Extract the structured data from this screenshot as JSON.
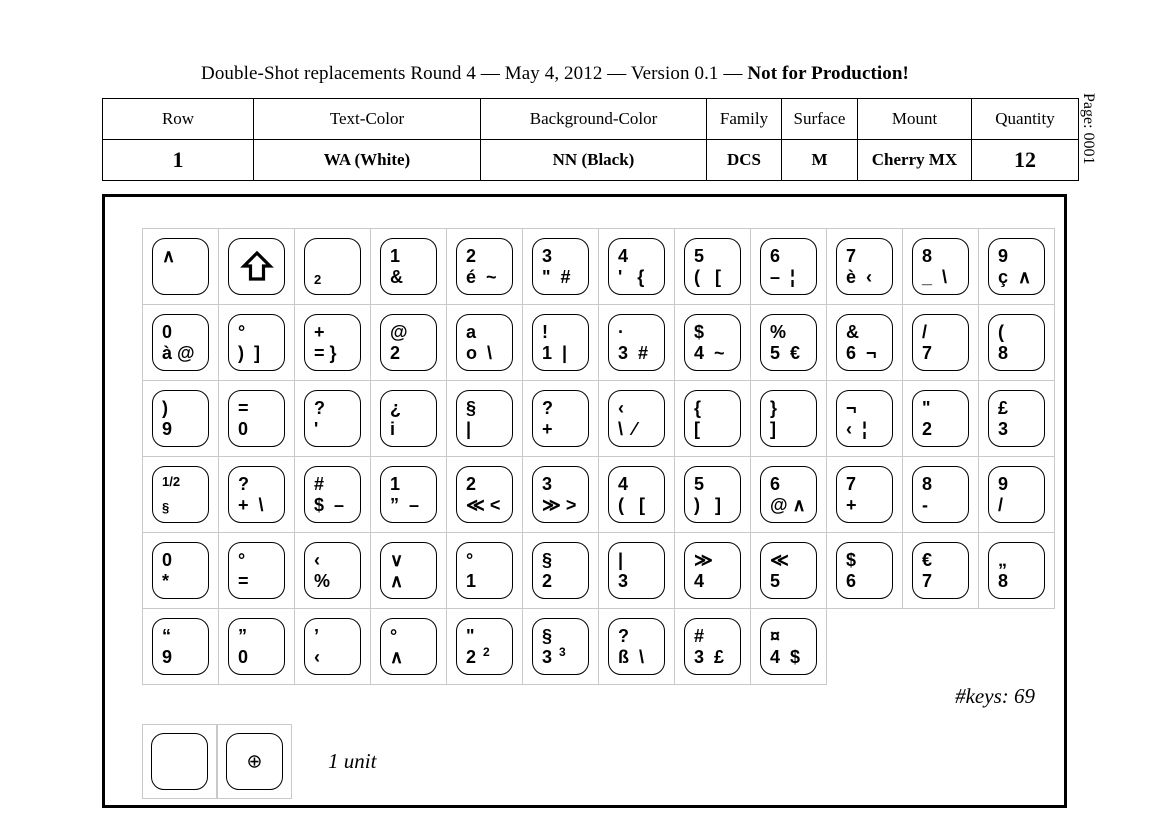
{
  "title": {
    "normal": "Double-Shot replacements Round 4 — May 4, 2012 — Version 0.1 — ",
    "bold": "Not for Production!"
  },
  "page_label": "Page: 0001",
  "info_table": {
    "headers": [
      "Row",
      "Text-Color",
      "Background-Color",
      "Family",
      "Surface",
      "Mount",
      "Quantity"
    ],
    "values": [
      "1",
      "WA (White)",
      "NN (Black)",
      "DCS",
      "M",
      "Cherry MX",
      "12"
    ]
  },
  "keys_note": "#keys: 69",
  "unit_legend": {
    "label": "1 unit",
    "marker": "⊕"
  },
  "key_rows": [
    [
      {
        "top": "∧",
        "bot": "",
        "align": "left"
      },
      {
        "icon": "shift-up-arrow"
      },
      {
        "top": "",
        "bot": "2",
        "align": "left",
        "small": true
      },
      {
        "top": "1",
        "bot": "&",
        "align": "left"
      },
      {
        "top": "2",
        "bot": "é  ~",
        "align": "left"
      },
      {
        "top": "3",
        "bot": "\"  #",
        "align": "left"
      },
      {
        "top": "4",
        "bot": "'   {",
        "align": "left"
      },
      {
        "top": "5",
        "bot": "(   [",
        "align": "left"
      },
      {
        "top": "6",
        "bot": "–  ¦",
        "align": "left"
      },
      {
        "top": "7",
        "bot": "è  ‹",
        "align": "left"
      },
      {
        "top": "8",
        "bot": "_  \\",
        "align": "left"
      },
      {
        "top": "9",
        "bot": "ç  ∧",
        "align": "left"
      }
    ],
    [
      {
        "top": "0",
        "bot": "à @",
        "align": "left"
      },
      {
        "top": "°",
        "bot": ")  ]",
        "align": "left"
      },
      {
        "top": "+",
        "bot": "= }",
        "align": "left"
      },
      {
        "top": "@",
        "bot": "2",
        "align": "left"
      },
      {
        "top": "a",
        "bot": "o  \\",
        "align": "left"
      },
      {
        "top": "!",
        "bot": "1  |",
        "align": "left"
      },
      {
        "top": "·",
        "bot": "3  #",
        "align": "left"
      },
      {
        "top": "$",
        "bot": "4  ~",
        "align": "left"
      },
      {
        "top": "%",
        "bot": "5  €",
        "align": "left"
      },
      {
        "top": "&",
        "bot": "6  ¬",
        "align": "left"
      },
      {
        "top": "/",
        "bot": "7",
        "align": "left"
      },
      {
        "top": "(",
        "bot": "8",
        "align": "left"
      }
    ],
    [
      {
        "top": ")",
        "bot": "9",
        "align": "left"
      },
      {
        "top": "=",
        "bot": "0",
        "align": "left"
      },
      {
        "top": "?",
        "bot": "'",
        "align": "left"
      },
      {
        "top": "¿",
        "bot": "i",
        "align": "left"
      },
      {
        "top": "§",
        "bot": "|",
        "align": "left"
      },
      {
        "top": "?",
        "bot": "+",
        "align": "left"
      },
      {
        "top": "‹",
        "bot": "\\  ⁄",
        "align": "left"
      },
      {
        "top": "{",
        "bot": "[",
        "align": "left"
      },
      {
        "top": "}",
        "bot": "]",
        "align": "left"
      },
      {
        "top": "¬",
        "bot": "‹  ¦",
        "align": "left"
      },
      {
        "top": "\"",
        "bot": "2",
        "align": "left"
      },
      {
        "top": "£",
        "bot": "3",
        "align": "left"
      }
    ],
    [
      {
        "top": "1/2",
        "bot": "§",
        "align": "left",
        "small": true
      },
      {
        "top": "?",
        "bot": "+  \\",
        "align": "left"
      },
      {
        "top": "#",
        "bot": "$  –",
        "align": "left"
      },
      {
        "top": "1",
        "bot": "”  –",
        "align": "left"
      },
      {
        "top": "2",
        "bot": "≪ <",
        "align": "left"
      },
      {
        "top": "3",
        "bot": "≫ >",
        "align": "left"
      },
      {
        "top": "4",
        "bot": "(   [",
        "align": "left"
      },
      {
        "top": "5",
        "bot": ")   ]",
        "align": "left"
      },
      {
        "top": "6",
        "bot": "@ ∧",
        "align": "left"
      },
      {
        "top": "7",
        "bot": "+",
        "align": "left"
      },
      {
        "top": "8",
        "bot": "-",
        "align": "left"
      },
      {
        "top": "9",
        "bot": "/",
        "align": "left"
      }
    ],
    [
      {
        "top": "0",
        "bot": "*",
        "align": "left"
      },
      {
        "top": "°",
        "bot": "=",
        "align": "left"
      },
      {
        "top": "‹",
        "bot": "%",
        "align": "left"
      },
      {
        "top": "∨",
        "bot": "∧",
        "align": "left"
      },
      {
        "top": "°",
        "bot": "1",
        "align": "left"
      },
      {
        "top": "§",
        "bot": "2",
        "align": "left"
      },
      {
        "top": "|",
        "bot": "3",
        "align": "left"
      },
      {
        "top": "≫",
        "bot": "4",
        "align": "left"
      },
      {
        "top": "≪",
        "bot": "5",
        "align": "left"
      },
      {
        "top": "$",
        "bot": "6",
        "align": "left"
      },
      {
        "top": "€",
        "bot": "7",
        "align": "left"
      },
      {
        "top": "„",
        "bot": "8",
        "align": "left"
      }
    ],
    [
      {
        "top": "“",
        "bot": "9",
        "align": "left"
      },
      {
        "top": "”",
        "bot": "0",
        "align": "left"
      },
      {
        "top": "’",
        "bot": "‹",
        "align": "left"
      },
      {
        "top": "°",
        "bot": "∧",
        "align": "left"
      },
      {
        "top": "\"",
        "bot": "2",
        "sup": "2",
        "align": "left"
      },
      {
        "top": "§",
        "bot": "3",
        "sup": "3",
        "align": "left"
      },
      {
        "top": "?",
        "bot": "ß  \\",
        "align": "left"
      },
      {
        "top": "#",
        "bot": "3  £",
        "align": "left"
      },
      {
        "top": "¤",
        "bot": "4  $",
        "align": "left"
      },
      null,
      null,
      null
    ]
  ]
}
